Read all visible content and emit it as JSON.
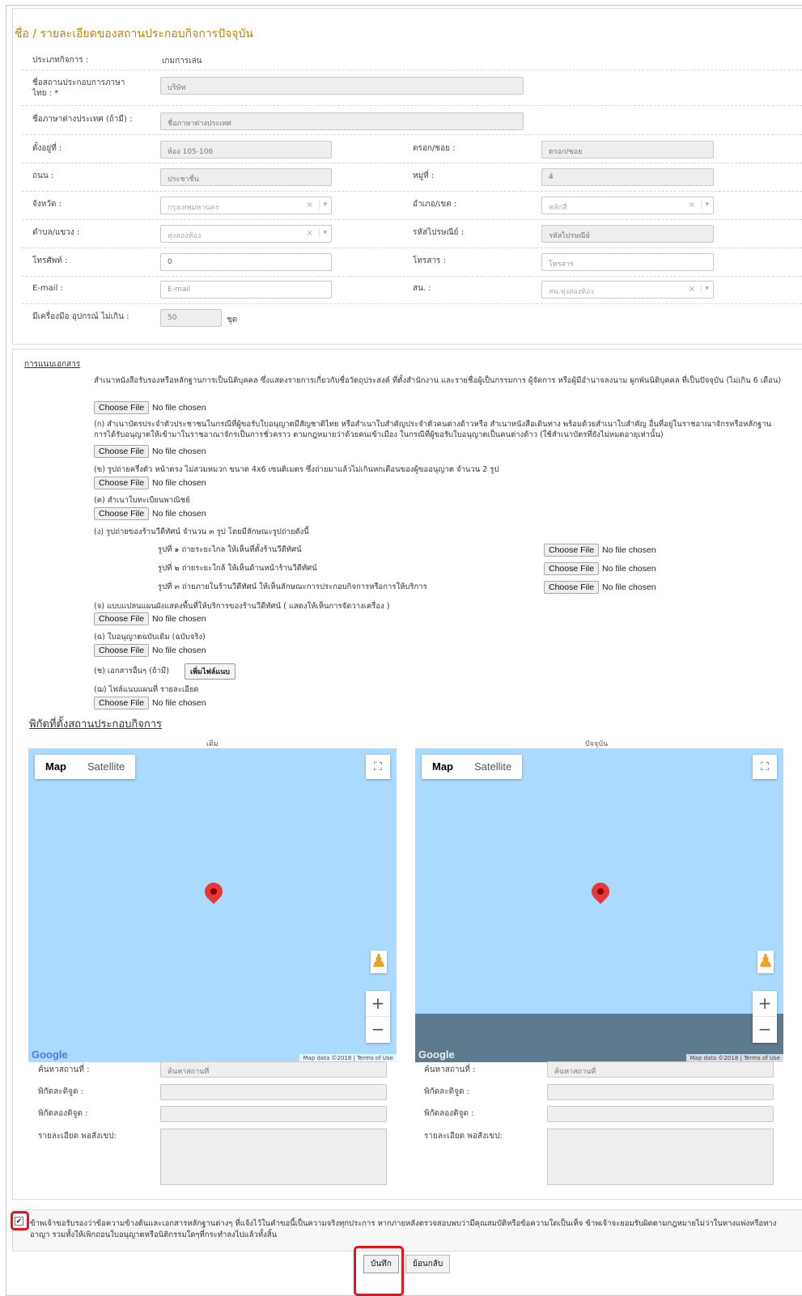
{
  "section_title": "ชื่อ / รายละเอียดของสถานประกอบกิจการปัจจุบัน",
  "business_type": {
    "label": "ประเภทกิจการ :",
    "value": "เกมการเล่น"
  },
  "name_th": {
    "label1": "ชื่อสถานประกอบการภาษา",
    "label2": "ไทย : *",
    "value": "บริษัท"
  },
  "name_foreign": {
    "label": "ชื่อภาษาต่างประเทศ (ถ้ามี) :",
    "placeholder": "ชื่อภาษาต่างประเทศ"
  },
  "address": {
    "label": "ตั้งอยู่ที่ :",
    "value": "ห้อง 105-106"
  },
  "soi": {
    "label": "ตรอก/ซอย :",
    "placeholder": "ตรอก/ซอย"
  },
  "road": {
    "label": "ถนน :",
    "value": "ประชาชื่น"
  },
  "moo": {
    "label": "หมู่ที่ :",
    "value": "4"
  },
  "province": {
    "label": "จังหวัด :",
    "value": "กรุงเทพมหานคร"
  },
  "district": {
    "label": "อำเภอ/เขต :",
    "value": "หลักสี่"
  },
  "subdistrict": {
    "label": "ตำบล/แขวง :",
    "value": "ทุ่งสองห้อง"
  },
  "postcode": {
    "label": "รหัสไปรษณีย์ :",
    "placeholder": "รหัสไปรษณีย์"
  },
  "phone": {
    "label": "โทรศัพท์ :",
    "value": "0"
  },
  "fax": {
    "label": "โทรสาร :",
    "placeholder": "โทรสาร"
  },
  "email": {
    "label": "E-mail :",
    "placeholder": "E-mail"
  },
  "station": {
    "label": "สน. :",
    "value": "สน.ทุ่งสองห้อง"
  },
  "equipment": {
    "label": "มีเครื่องมือ อุปกรณ์ ไม่เกิน :",
    "value": "50",
    "unit": "ชุด"
  },
  "attachments": {
    "heading": "การแนบเอกสาร",
    "choose_label": "Choose File",
    "none_label": "No file chosen",
    "add_label": "เพิ่มไฟล์แนบ",
    "item0": "สำเนาหนังสือรับรองหรือหลักฐานการเป็นนิติบุคคล ซึ่งแสดงรายการเกี่ยวกับชื่อวัตถุประสงค์ ที่ตั้งสำนักงาน และรายชื่อผู้เป็นกรรมการ ผู้จัดการ หรือผู้มีอำนาจลงนาม ผูกพันนิติบุคคล ที่เป็นปัจจุบัน (ไม่เกิน 6 เดือน)",
    "item1": "(ก) สำเนาบัตรประจำตัวประชาชนในกรณีที่ผู้ขอรับใบอนุญาตมีสัญชาติไทย หรือสำเนาใบสำคัญประจำตัวคนต่างด้าวหรือ สำเนาหนังสือเดินทาง พร้อมด้วยสำเนาใบสำคัญ อื่นที่อยู่ในราชอาณาจักรหรือหลักฐานการได้รับอนุญาตให้เข้ามาในราชอาณาจักรเป็นการชั่วคราว ตามกฎหมายว่าด้วยคนเข้าเมือง ในกรณีที่ผู้ขอรับใบอนุญาตเป็นคนต่างด้าว (ใช้สำเนาบัตรที่ยังไม่หมดอายุเท่านั้น)",
    "item2": "(ข) รูปถ่ายครึ่งตัว หน้าตรง ไม่สวมหมวก ขนาด 4x6 เซนติเมตร ซึ่งถ่ายมาแล้วไม่เกินหกเดือนของผู้ขออนุญาต จำนวน 2 รูป",
    "item3": "(ค) สำเนาใบทะเบียนพาณิชย์",
    "item4": "(ง) รูปถ่ายของร้านวีดีทัศน์ จำนวน ๓ รูป โดยมีลักษณะรูปถ่ายดังนี้",
    "photo1": "รูปที่ ๑ ถ่ายระยะไกล ให้เห็นที่ตั้งร้านวีดีทัศน์",
    "photo2": "รูปที่ ๒ ถ่ายระยะใกล้ ให้เห็นด้านหน้าร้านวีดีทัศน์",
    "photo3": "รูปที่ ๓ ถ่ายภายในร้านวีดีทัศน์ ให้เห็นลักษณะการประกอบกิจการหรือการให้บริการ",
    "item5": "(จ) แบบแปลนแผนผังแสดงพื้นที่ให้บริการของร้านวีดีทัศน์ ( แสดงให้เห็นการจัดวางเครื่อง )",
    "item6": "(ฉ) ใบอนุญาตฉบับเดิม (ฉบับจริง)",
    "item7": "(ช) เอกสารอื่นๆ (ถ้ามี)",
    "item8": "(ฌ) ไฟล์แนบแผนที่ รายละเอียด"
  },
  "location": {
    "title": "พิกัดที่ตั้งสถานประกอบกิจการ",
    "left_caption": "เดิม",
    "right_caption": "ปัจจุบัน",
    "map_tab": "Map",
    "satellite_tab": "Satellite",
    "google": "Google",
    "attribution": "Map data ©2018 | Terms of Use",
    "search_label": "ค้นหาสถานที่ :",
    "search_placeholder": "ค้นหาสถานที่",
    "lat_label": "พิกัดละติจูด :",
    "lng_label": "พิกัดลองติจูด :",
    "detail_label": "รายละเอียด พอสังเขป:"
  },
  "consent": {
    "checked": "✔",
    "text": "ข้าพเจ้าขอรับรองว่าข้อความข้างต้นและเอกสารหลักฐานต่างๆ ที่แจ้งไว้ในคำขอนี้เป็นความจริงทุกประการ หากภายหลังตรวจสอบพบว่ามีคุณสมบัติหรือข้อความใดเป็นเท็จ ข้าพเจ้าจะยอมรับผิดตามกฎหมายไม่ว่าในทางแพ่งหรือทางอาญา รวมทั้งให้เพิกถอนใบอนุญาตหรือนิติกรรมใดๆที่กระทำลงไปแล้วทั้งสิ้น"
  },
  "buttons": {
    "save": "บันทึก",
    "back": "ย้อนกลับ"
  }
}
